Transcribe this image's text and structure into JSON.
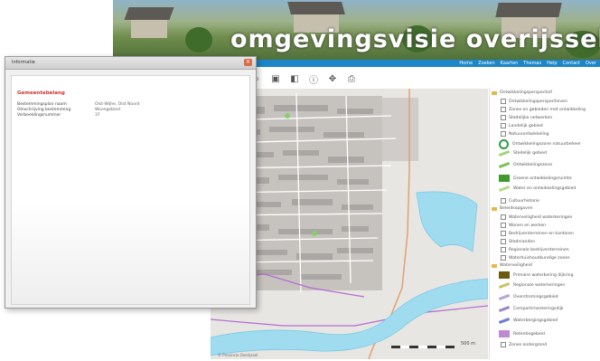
{
  "banner": {
    "title": "omgevingsvisie  overijssel",
    "nav_links": [
      "Home",
      "Zoeken",
      "Kaarten",
      "Themas",
      "Help",
      "Contact",
      "Over"
    ]
  },
  "toolbar": {
    "tools": [
      "zoom-in-icon",
      "zoom-out-icon",
      "layers-icon",
      "info-icon",
      "pan-icon",
      "print-icon"
    ],
    "glyphs": [
      "⌕",
      "▣",
      "◧",
      "ⓘ",
      "✥",
      "⎙"
    ]
  },
  "map": {
    "scale_label": "500 m",
    "copyright": "© Provincie Overijssel"
  },
  "dialog": {
    "title": "Informatie",
    "heading": "Gemeentebelang",
    "rows": [
      {
        "key": "Bestemmingsplan naam",
        "value": "Olst-Wijhe, Olst Noord"
      },
      {
        "key": "Omschrijving bestemming",
        "value": "Woongebied"
      },
      {
        "key": "Verbeeldingsnummer",
        "value": "37"
      }
    ]
  },
  "legend": {
    "items": [
      {
        "kind": "header",
        "label": "Ontwikkelingsperspectief"
      },
      {
        "kind": "check",
        "label": "Ontwikkelingsperspectieven"
      },
      {
        "kind": "check",
        "label": "Zones en gebieden met ontwikkeling"
      },
      {
        "kind": "check",
        "label": "Stedelijke netwerken"
      },
      {
        "kind": "check",
        "label": "Landelijk gebied"
      },
      {
        "kind": "check",
        "label": "Natuurontwikkeling"
      },
      {
        "kind": "sym",
        "symbol": "ring",
        "color": "#2e9b4a",
        "label": "Ontwikkelingszone natuurbeheer"
      },
      {
        "kind": "sym",
        "symbol": "line",
        "color": "#aad27a",
        "label": "Stedelijk gebied"
      },
      {
        "kind": "sym",
        "symbol": "line",
        "color": "#7fbf5a",
        "label": "Ontwikkelingszone"
      },
      {
        "kind": "sym",
        "symbol": "box",
        "color": "#3f9a2e",
        "label": "Groene ontwikkelingsruimte"
      },
      {
        "kind": "sym",
        "symbol": "line",
        "color": "#b9d98a",
        "label": "Water en ontwikkelingsgebied"
      },
      {
        "kind": "check",
        "label": "Cultuurhistorie"
      },
      {
        "kind": "header",
        "label": "Beleidsopgaven"
      },
      {
        "kind": "check",
        "label": "Waterveiligheid waterkeringen"
      },
      {
        "kind": "check",
        "label": "Wonen en werken"
      },
      {
        "kind": "check",
        "label": "Bedrijventerreinen en kantoren"
      },
      {
        "kind": "check",
        "label": "Stadsranden"
      },
      {
        "kind": "check",
        "label": "Regionale bedrijventerreinen"
      },
      {
        "kind": "check",
        "label": "Waterhuishoudkundige zones"
      },
      {
        "kind": "header",
        "label": "Waterveiligheid"
      },
      {
        "kind": "sym",
        "symbol": "box",
        "color": "#6d5a10",
        "label": "Primaire waterkering dijkring"
      },
      {
        "kind": "sym",
        "symbol": "line",
        "color": "#c9c16a",
        "label": "Regionale waterkeringen"
      },
      {
        "kind": "sym",
        "symbol": "line",
        "color": "#b7a6d6",
        "label": "Overstromingsgebied"
      },
      {
        "kind": "sym",
        "symbol": "line",
        "color": "#9b88cc",
        "label": "Compartimenteringsdijk"
      },
      {
        "kind": "sym",
        "symbol": "line",
        "color": "#6a7fd1",
        "label": "Waterbergingsgebied"
      },
      {
        "kind": "sym",
        "symbol": "box",
        "color": "#c08ad3",
        "label": "Retentiegebied"
      },
      {
        "kind": "check",
        "label": "Zones ondergrond"
      }
    ]
  },
  "colors": {
    "accent": "#1c86c8",
    "river": "#9fdcef",
    "route": "#e1a070",
    "heading": "#d0312d"
  }
}
